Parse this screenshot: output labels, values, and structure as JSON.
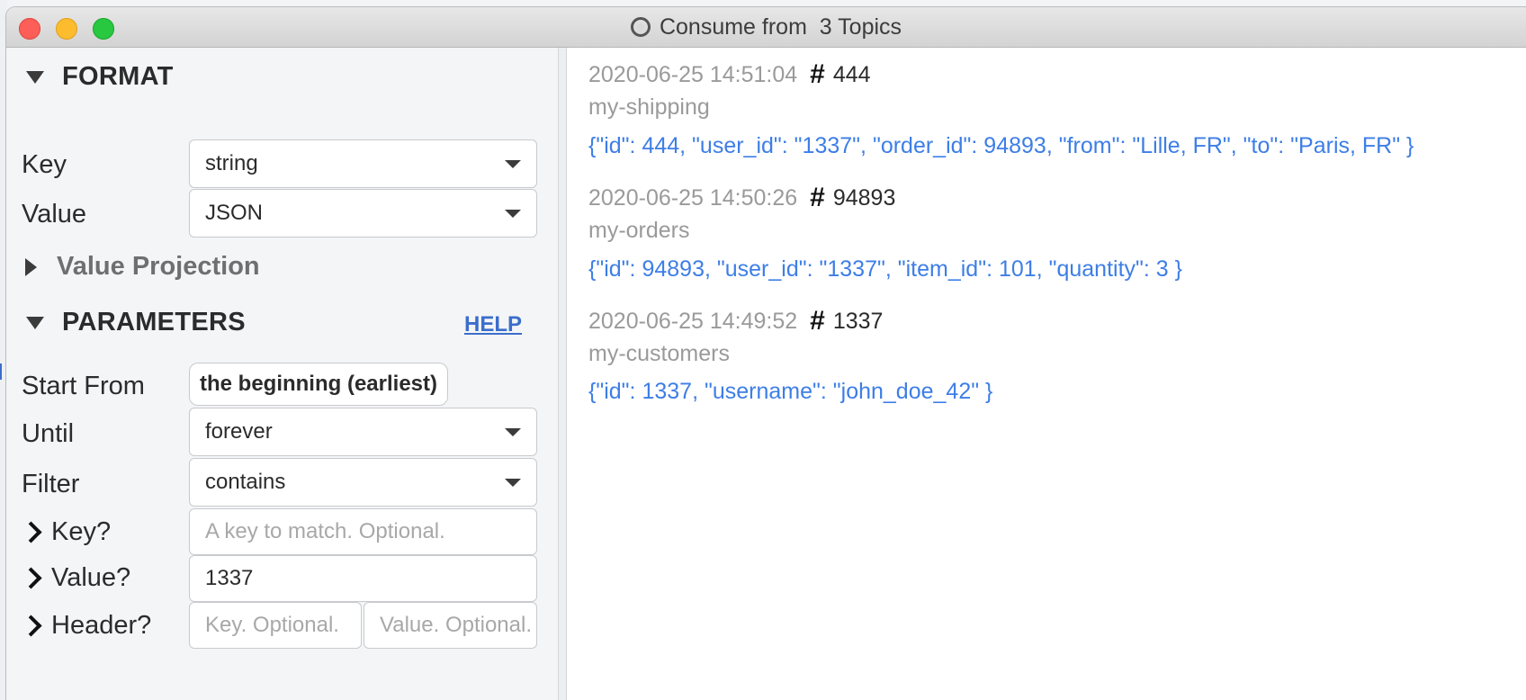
{
  "window": {
    "title": "Consume from  3 Topics"
  },
  "format": {
    "section_label": "FORMAT",
    "key_label": "Key",
    "key_value": "string",
    "value_label": "Value",
    "value_value": "JSON",
    "projection_label": "Value Projection"
  },
  "parameters": {
    "section_label": "PARAMETERS",
    "help_label": "HELP",
    "start_from_label": "Start From",
    "start_from_value": "the beginning (earliest)",
    "until_label": "Until",
    "until_value": "forever",
    "filter_label": "Filter",
    "filter_value": "contains",
    "key_filter_label": "Key?",
    "key_filter_placeholder": "A key to match. Optional.",
    "value_filter_label": "Value?",
    "value_filter_value": "1337",
    "header_filter_label": "Header?",
    "header_key_placeholder": "Key. Optional.",
    "header_value_placeholder": "Value. Optional."
  },
  "messages": [
    {
      "timestamp": "2020-06-25 14:51:04",
      "hash": "#",
      "offset": "444",
      "topic": "my-shipping",
      "payload": "{\"id\": 444, \"user_id\": \"1337\", \"order_id\": 94893, \"from\": \"Lille, FR\", \"to\": \"Paris, FR\" }"
    },
    {
      "timestamp": "2020-06-25 14:50:26",
      "hash": "#",
      "offset": "94893",
      "topic": "my-orders",
      "payload": "{\"id\": 94893, \"user_id\": \"1337\", \"item_id\": 101, \"quantity\": 3 }"
    },
    {
      "timestamp": "2020-06-25 14:49:52",
      "hash": "#",
      "offset": "1337",
      "topic": "my-customers",
      "payload": "{\"id\": 1337, \"username\": \"john_doe_42\" }"
    }
  ]
}
